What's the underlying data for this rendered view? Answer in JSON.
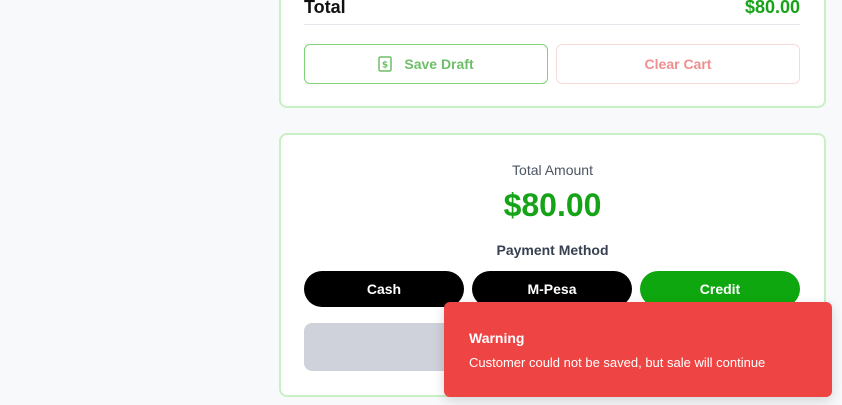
{
  "cart": {
    "total_label": "Total",
    "total_value": "$80.00",
    "save_draft_label": "Save Draft",
    "save_draft_icon": "receipt-icon",
    "clear_cart_label": "Clear Cart"
  },
  "payment": {
    "amount_label": "Total Amount",
    "amount_value": "$80.00",
    "method_label": "Payment Method",
    "methods": [
      {
        "label": "Cash",
        "selected": false
      },
      {
        "label": "M-Pesa",
        "selected": false
      },
      {
        "label": "Credit",
        "selected": true
      }
    ],
    "complete_label": ""
  },
  "toast": {
    "title": "Warning",
    "message": "Customer could not be saved, but sale will continue"
  },
  "colors": {
    "accent_green": "#16a318",
    "selected_method": "#0ea70f",
    "toast_bg": "#ef4444"
  }
}
